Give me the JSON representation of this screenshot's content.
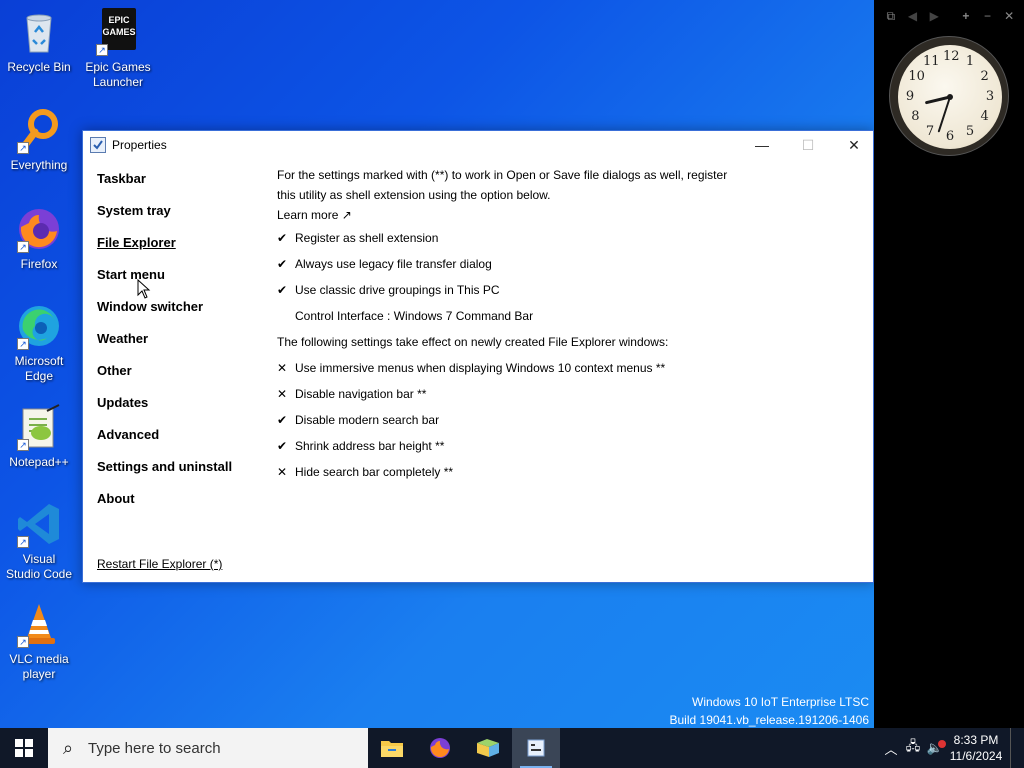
{
  "desktop": {
    "icons": [
      {
        "label": "Recycle Bin"
      },
      {
        "label": "Epic Games Launcher",
        "logo_text": "EPIC GAMES"
      },
      {
        "label": "Everything"
      },
      {
        "label": "Firefox"
      },
      {
        "label": "Microsoft Edge"
      },
      {
        "label": "Notepad++"
      },
      {
        "label": "Visual Studio Code"
      },
      {
        "label": "VLC media player"
      }
    ]
  },
  "clock_gadget": {
    "numbers": [
      "12",
      "1",
      "2",
      "3",
      "4",
      "5",
      "6",
      "7",
      "8",
      "9",
      "10",
      "11"
    ],
    "time_shown": "8:33"
  },
  "window": {
    "title": "Properties",
    "controls": {
      "minimize": "—",
      "maximize": "☐",
      "close": "✕"
    },
    "nav": [
      {
        "label": "Taskbar"
      },
      {
        "label": "System tray"
      },
      {
        "label": "File Explorer",
        "active": true
      },
      {
        "label": "Start menu"
      },
      {
        "label": "Window switcher"
      },
      {
        "label": "Weather"
      },
      {
        "label": "Other"
      },
      {
        "label": "Updates"
      },
      {
        "label": "Advanced"
      },
      {
        "label": "Settings and uninstall"
      },
      {
        "label": "About"
      }
    ],
    "restart_link": "Restart File Explorer (*)",
    "intro_line1": "For the settings marked with (**) to work in Open or Save file dialogs as well, register",
    "intro_line2": "this utility as shell extension using the option below.",
    "learn_more": "Learn more ↗",
    "options_group1": [
      {
        "mark": "✔",
        "label": "Register as shell extension"
      },
      {
        "mark": "✔",
        "label": "Always use legacy file transfer dialog"
      },
      {
        "mark": "✔",
        "label": "Use classic drive groupings in This PC"
      },
      {
        "mark": "",
        "label": "Control Interface : Windows 7 Command Bar"
      }
    ],
    "note": "The following settings take effect on newly created File Explorer windows:",
    "options_group2": [
      {
        "mark": "✕",
        "label": "Use immersive menus when displaying Windows 10 context menus **"
      },
      {
        "mark": "✕",
        "label": "Disable navigation bar **"
      },
      {
        "mark": "✔",
        "label": "Disable modern search bar"
      },
      {
        "mark": "✔",
        "label": "Shrink address bar height **"
      },
      {
        "mark": "✕",
        "label": "Hide search bar completely **"
      }
    ]
  },
  "watermark": {
    "line1": "Windows 10 IoT Enterprise LTSC",
    "line2": "Build 19041.vb_release.191206-1406"
  },
  "taskbar": {
    "search_placeholder": "Type here to search",
    "apps": [
      "File Explorer",
      "Firefox",
      "Files",
      "Properties"
    ],
    "time": "8:33 PM",
    "date": "11/6/2024"
  },
  "colors": {
    "accent": "#0d55e6",
    "taskbar": "#101828"
  }
}
